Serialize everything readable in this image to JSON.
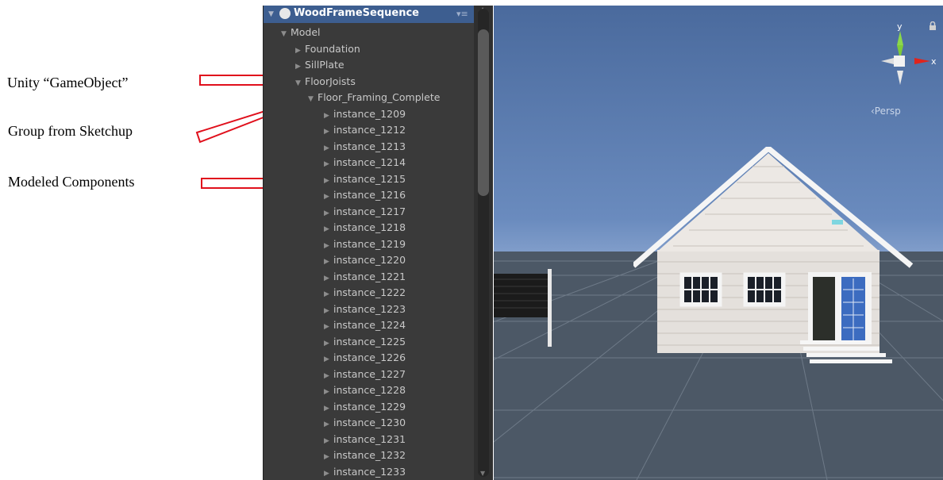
{
  "annotations": {
    "gameobject": "Unity “GameObject”",
    "group": "Group from Sketchup",
    "components": "Modeled Components"
  },
  "hierarchy": {
    "title": "WoodFrameSequence",
    "items": [
      {
        "label": "Model",
        "level": 0,
        "expanded": true
      },
      {
        "label": "Foundation",
        "level": 1,
        "expanded": false
      },
      {
        "label": "SillPlate",
        "level": 1,
        "expanded": false
      },
      {
        "label": "FloorJoists",
        "level": 1,
        "expanded": true
      },
      {
        "label": "Floor_Framing_Complete",
        "level": 2,
        "expanded": true
      },
      {
        "label": "instance_1209",
        "level": 3,
        "expanded": false
      },
      {
        "label": "instance_1212",
        "level": 3,
        "expanded": false
      },
      {
        "label": "instance_1213",
        "level": 3,
        "expanded": false
      },
      {
        "label": "instance_1214",
        "level": 3,
        "expanded": false
      },
      {
        "label": "instance_1215",
        "level": 3,
        "expanded": false
      },
      {
        "label": "instance_1216",
        "level": 3,
        "expanded": false
      },
      {
        "label": "instance_1217",
        "level": 3,
        "expanded": false
      },
      {
        "label": "instance_1218",
        "level": 3,
        "expanded": false
      },
      {
        "label": "instance_1219",
        "level": 3,
        "expanded": false
      },
      {
        "label": "instance_1220",
        "level": 3,
        "expanded": false
      },
      {
        "label": "instance_1221",
        "level": 3,
        "expanded": false
      },
      {
        "label": "instance_1222",
        "level": 3,
        "expanded": false
      },
      {
        "label": "instance_1223",
        "level": 3,
        "expanded": false
      },
      {
        "label": "instance_1224",
        "level": 3,
        "expanded": false
      },
      {
        "label": "instance_1225",
        "level": 3,
        "expanded": false
      },
      {
        "label": "instance_1226",
        "level": 3,
        "expanded": false
      },
      {
        "label": "instance_1227",
        "level": 3,
        "expanded": false
      },
      {
        "label": "instance_1228",
        "level": 3,
        "expanded": false
      },
      {
        "label": "instance_1229",
        "level": 3,
        "expanded": false
      },
      {
        "label": "instance_1230",
        "level": 3,
        "expanded": false
      },
      {
        "label": "instance_1231",
        "level": 3,
        "expanded": false
      },
      {
        "label": "instance_1232",
        "level": 3,
        "expanded": false
      },
      {
        "label": "instance_1233",
        "level": 3,
        "expanded": false
      }
    ]
  },
  "scene": {
    "gizmo": {
      "y_label": "y",
      "x_label": "x"
    },
    "projection_label": "‹Persp"
  },
  "colors": {
    "panel_bg": "#3a3a3a",
    "header_bg": "#3d5e90",
    "arrow_red": "#e0101c",
    "sky": "#6a8bbe",
    "ground": "#4c5866"
  },
  "icons": [
    "unity-logo-icon",
    "menu-icon",
    "expand-arrow-icon",
    "collapse-arrow-icon",
    "lock-icon",
    "scene-gizmo-icon"
  ]
}
